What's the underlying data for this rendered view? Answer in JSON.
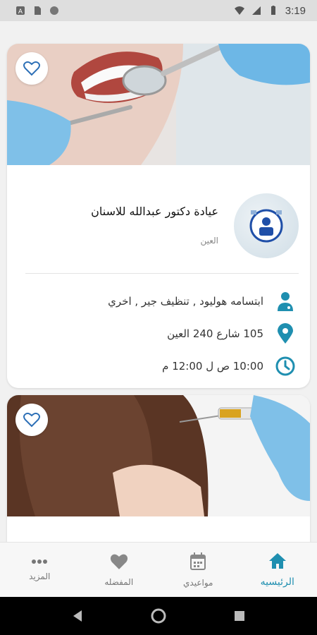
{
  "status_bar": {
    "time": "3:19"
  },
  "cards": [
    {
      "clinic_name": "عيادة دكتور عبدالله للاسنان",
      "city": "العين",
      "services": "ابتسامه هوليود , تنظيف جير , اخري",
      "address": "105 شارع 240 العين",
      "hours": "10:00 ص ل 12:00 م"
    }
  ],
  "bottom_nav": {
    "home": "الرئيسيه",
    "appointments": "مواعيدي",
    "favorites": "المفضله",
    "more": "المزيد"
  },
  "colors": {
    "accent": "#1f8fb0"
  }
}
